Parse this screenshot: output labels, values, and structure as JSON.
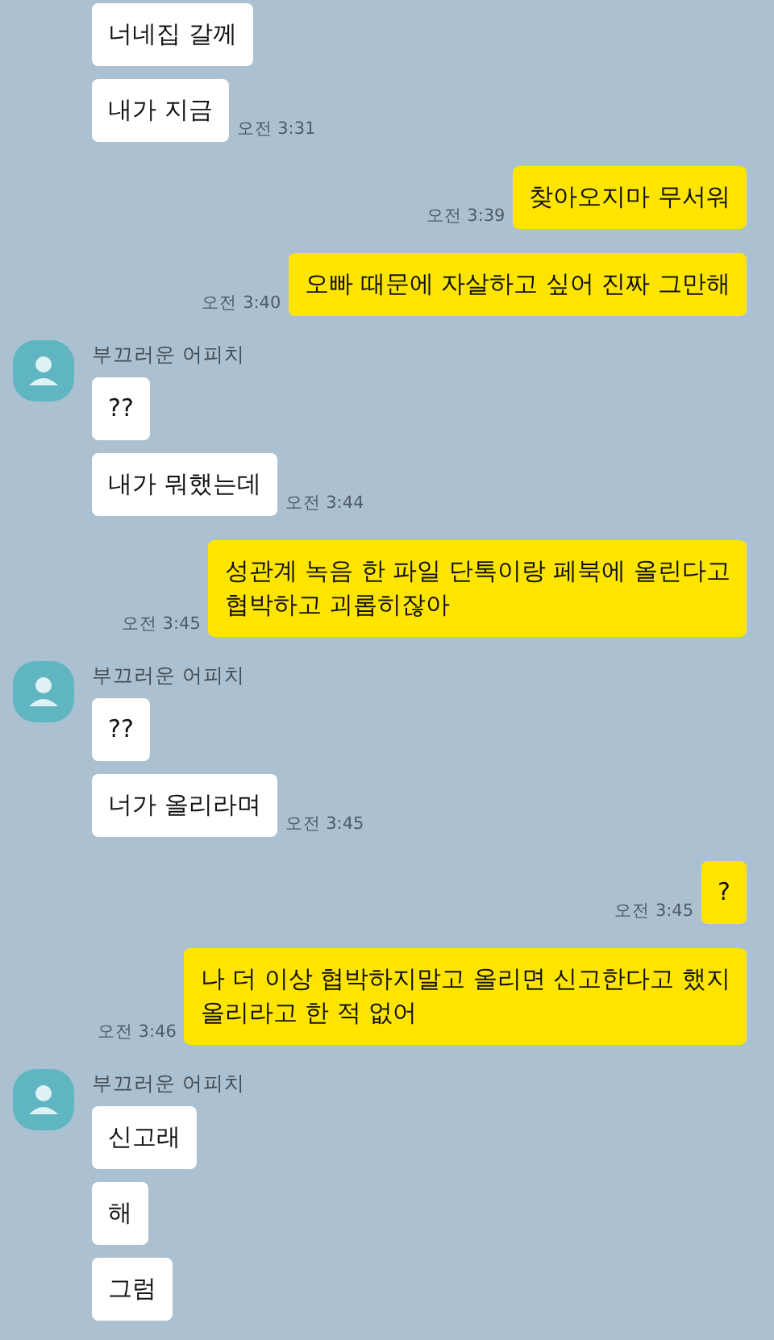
{
  "groups": [
    {
      "kind": "received",
      "messages": [
        {
          "text": "너네집 갈께"
        },
        {
          "text": "내가 지금",
          "time": "오전 3:31"
        }
      ]
    },
    {
      "kind": "sent",
      "messages": [
        {
          "text": "찾아오지마 무서워",
          "time": "오전 3:39"
        }
      ]
    },
    {
      "kind": "sent",
      "messages": [
        {
          "text": "오빠 때문에 자살하고 싶어 진짜 그만해",
          "time": "오전 3:40"
        }
      ]
    },
    {
      "kind": "received",
      "sender": "부끄러운 어피치",
      "messages": [
        {
          "text": "??"
        },
        {
          "text": "내가 뭐했는데",
          "time": "오전 3:44"
        }
      ]
    },
    {
      "kind": "sent",
      "messages": [
        {
          "text": "성관계 녹음 한 파일 단톡이랑 페북에 올린다고\n협박하고 괴롭히잖아",
          "time": "오전 3:45"
        }
      ]
    },
    {
      "kind": "received",
      "sender": "부끄러운 어피치",
      "messages": [
        {
          "text": "??"
        },
        {
          "text": "너가 올리라며",
          "time": "오전 3:45"
        }
      ]
    },
    {
      "kind": "sent",
      "messages": [
        {
          "text": "?",
          "time": "오전 3:45"
        }
      ]
    },
    {
      "kind": "sent",
      "messages": [
        {
          "text": "나 더 이상 협박하지말고 올리면 신고한다고 했지\n올리라고 한 적 없어",
          "time": "오전 3:46"
        }
      ]
    },
    {
      "kind": "received",
      "sender": "부끄러운 어피치",
      "messages": [
        {
          "text": "신고래"
        },
        {
          "text": "해"
        },
        {
          "text": "그럼"
        }
      ]
    }
  ]
}
